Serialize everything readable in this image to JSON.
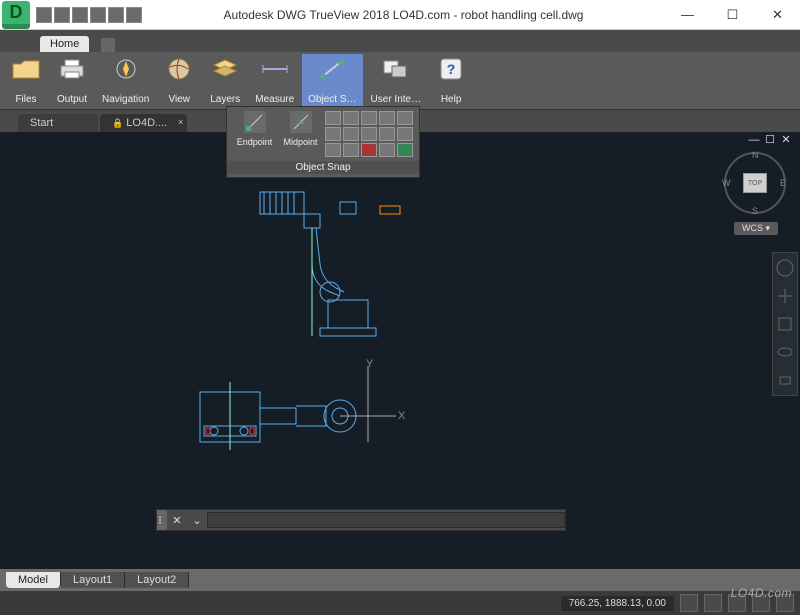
{
  "window": {
    "app_char": "D",
    "title": "Autodesk DWG TrueView 2018    LO4D.com - robot handling cell.dwg",
    "min": "—",
    "max": "☐",
    "close": "✕"
  },
  "menu": {
    "home": "Home"
  },
  "ribbon": {
    "panels": [
      {
        "label": "Files",
        "icon": "folder"
      },
      {
        "label": "Output",
        "icon": "printer"
      },
      {
        "label": "Navigation",
        "icon": "compass"
      },
      {
        "label": "View",
        "icon": "globe"
      },
      {
        "label": "Layers",
        "icon": "layers"
      },
      {
        "label": "Measure",
        "icon": "ruler"
      },
      {
        "label": "Object S…",
        "icon": "snap",
        "active": true
      },
      {
        "label": "User Inte…",
        "icon": "ui"
      },
      {
        "label": "Help",
        "icon": "help"
      }
    ]
  },
  "snap_panel": {
    "title": "Object Snap",
    "labelled": [
      "Endpoint",
      "Midpoint"
    ],
    "grid_icons": [
      "center",
      "node",
      "quadrant",
      "intersection",
      "insertion",
      "perpendicular",
      "tangent",
      "nearest",
      "apparent",
      "parallel",
      "none",
      "extension",
      "from",
      "mid2",
      "tracking"
    ]
  },
  "file_tabs": [
    {
      "label": "Start",
      "active": false
    },
    {
      "label": "LO4D....",
      "active": true,
      "lock": "🔒"
    }
  ],
  "viewport": {
    "vp_buttons": [
      "—",
      "☐",
      "✕"
    ],
    "viewcube_face": "TOP",
    "compass": {
      "n": "N",
      "e": "E",
      "s": "S",
      "w": "W"
    },
    "wcs": "WCS ▾",
    "axes": {
      "x": "X",
      "y": "Y"
    }
  },
  "nav_tools": [
    "wheel",
    "pan",
    "zoom-extents",
    "orbit",
    "showmotion"
  ],
  "cmdline": {
    "close": "✕",
    "chevron": "⌄"
  },
  "layout_tabs": [
    {
      "label": "Model",
      "active": true
    },
    {
      "label": "Layout1"
    },
    {
      "label": "Layout2"
    }
  ],
  "status": {
    "coords": "766.25, 1888.13, 0.00",
    "tools": [
      "grid",
      "model",
      "scale",
      "custom",
      "clean"
    ]
  },
  "watermark": "LO4D.com"
}
